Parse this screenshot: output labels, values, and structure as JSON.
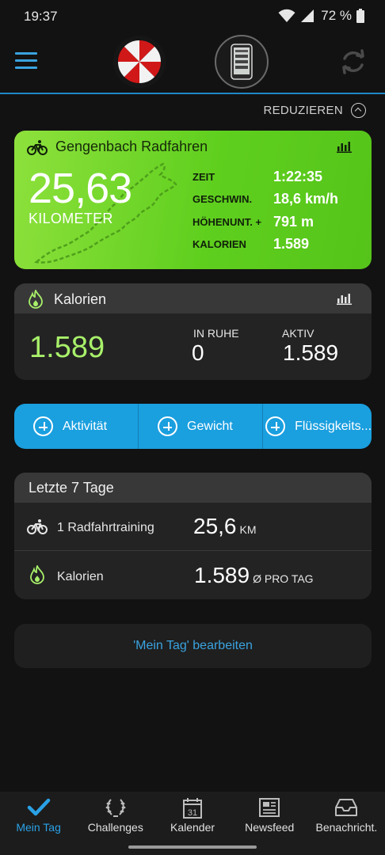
{
  "status_bar": {
    "time": "19:37",
    "battery": "72 %"
  },
  "header": {
    "menu_icon": "hamburger-menu-icon",
    "sync_icon": "sync-icon"
  },
  "reduce": {
    "label": "REDUZIEREN"
  },
  "activity": {
    "title": "Gengenbach Radfahren",
    "distance": "25,63",
    "distance_unit": "KILOMETER",
    "stats": [
      {
        "label": "ZEIT",
        "value": "1:22:35"
      },
      {
        "label": "GESCHWIN.",
        "value": "18,6 km/h"
      },
      {
        "label": "HÖHENUNT. +",
        "value": "791 m"
      },
      {
        "label": "KALORIEN",
        "value": "1.589"
      }
    ],
    "color": "#6bd52a"
  },
  "calories": {
    "title": "Kalorien",
    "total": "1.589",
    "rest_label": "IN RUHE",
    "rest_value": "0",
    "active_label": "AKTIV",
    "active_value": "1.589"
  },
  "actions": [
    {
      "label": "Aktivität"
    },
    {
      "label": "Gewicht"
    },
    {
      "label": "Flüssigkeits..."
    }
  ],
  "week": {
    "title": "Letzte 7 Tage",
    "rows": [
      {
        "label": "1 Radfahrtraining",
        "value": "25,6",
        "unit": "KM"
      },
      {
        "label": "Kalorien",
        "value": "1.589",
        "unit": "Ø PRO TAG"
      }
    ]
  },
  "edit": {
    "label": "'Mein Tag' bearbeiten"
  },
  "nav": [
    {
      "label": "Mein Tag",
      "icon": "checkmark-icon",
      "active": true
    },
    {
      "label": "Challenges",
      "icon": "laurel-icon"
    },
    {
      "label": "Kalender",
      "icon": "calendar-icon",
      "day": "31"
    },
    {
      "label": "Newsfeed",
      "icon": "newspaper-icon"
    },
    {
      "label": "Benachricht.",
      "icon": "inbox-icon"
    }
  ],
  "colors": {
    "accent": "#1a9fdf",
    "green": "#a8f06a"
  }
}
